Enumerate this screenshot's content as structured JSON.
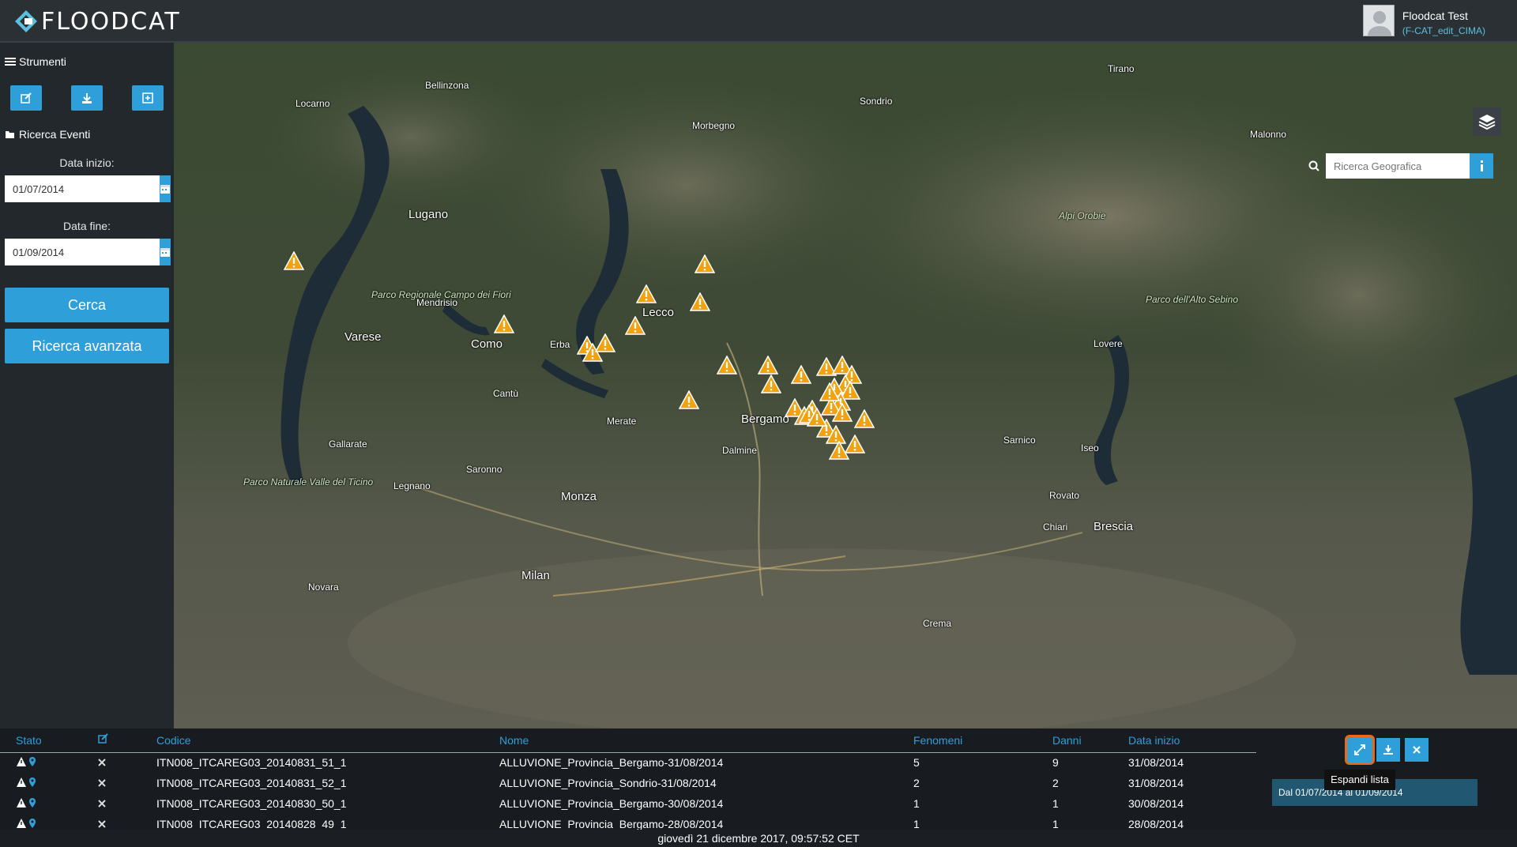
{
  "header": {
    "logo_text": "FLOODCAT",
    "user_name": "Floodcat Test",
    "user_role": "(F-CAT_edit_CIMA)"
  },
  "sidebar": {
    "tools_title": "Strumenti",
    "tool_buttons": [
      "edit-icon",
      "download-icon",
      "expand-icon"
    ],
    "search_title": "Ricerca Eventi",
    "start_label": "Data inizio:",
    "start_value": "01/07/2014",
    "end_label": "Data fine:",
    "end_value": "01/09/2014",
    "search_button": "Cerca",
    "advanced_button": "Ricerca avanzata"
  },
  "map": {
    "geo_search_placeholder": "Ricerca Geografica",
    "places": [
      {
        "name": "Milan",
        "big": true
      },
      {
        "name": "Bergamo",
        "big": true
      },
      {
        "name": "Brescia",
        "big": true
      },
      {
        "name": "Lecco",
        "big": true
      },
      {
        "name": "Como",
        "big": true
      },
      {
        "name": "Varese",
        "big": true
      },
      {
        "name": "Lugano",
        "big": true
      },
      {
        "name": "Monza",
        "big": true
      },
      {
        "name": "Sondrio",
        "big": false
      },
      {
        "name": "Locarno",
        "big": false
      },
      {
        "name": "Novara",
        "big": false
      },
      {
        "name": "Saronno",
        "big": false
      },
      {
        "name": "Legnano",
        "big": false
      },
      {
        "name": "Gallarate",
        "big": false
      },
      {
        "name": "Cantù",
        "big": false
      },
      {
        "name": "Erba",
        "big": false
      },
      {
        "name": "Crema",
        "big": false
      },
      {
        "name": "Lovere",
        "big": false
      },
      {
        "name": "Sarnico",
        "big": false
      },
      {
        "name": "Dalmine",
        "big": false
      },
      {
        "name": "Merate",
        "big": false
      },
      {
        "name": "Mendrisio",
        "big": false
      },
      {
        "name": "Bellinzona",
        "big": false
      },
      {
        "name": "Morbegno",
        "big": false
      },
      {
        "name": "Chiari",
        "big": false
      },
      {
        "name": "Rovato",
        "big": false
      },
      {
        "name": "Iseo",
        "big": false
      },
      {
        "name": "Malonno",
        "big": false
      },
      {
        "name": "Tirano",
        "big": false
      },
      {
        "name": "Parco dell'Alto Sebino",
        "big": false
      },
      {
        "name": "Parco Regionale Campo dei Fiori",
        "big": false
      },
      {
        "name": "Parco Naturale Valle del Ticino",
        "big": false
      },
      {
        "name": "Alpi Orobie",
        "big": false
      }
    ]
  },
  "results": {
    "columns": [
      "Stato",
      "edit-icon",
      "Codice",
      "Nome",
      "Fenomeni",
      "Danni",
      "Data inizio"
    ],
    "rows": [
      {
        "codice": "ITN008_ITCAREG03_20140831_51_1",
        "nome": "ALLUVIONE_Provincia_Bergamo-31/08/2014",
        "fenomeni": "5",
        "danni": "9",
        "data": "31/08/2014"
      },
      {
        "codice": "ITN008_ITCAREG03_20140831_52_1",
        "nome": "ALLUVIONE_Provincia_Sondrio-31/08/2014",
        "fenomeni": "2",
        "danni": "2",
        "data": "31/08/2014"
      },
      {
        "codice": "ITN008_ITCAREG03_20140830_50_1",
        "nome": "ALLUVIONE_Provincia_Bergamo-30/08/2014",
        "fenomeni": "1",
        "danni": "1",
        "data": "30/08/2014"
      },
      {
        "codice": "ITN008_ITCAREG03_20140828_49_1",
        "nome": "ALLUVIONE_Provincia_Bergamo-28/08/2014",
        "fenomeni": "1",
        "danni": "1",
        "data": "28/08/2014"
      }
    ],
    "tooltip": "Espandi lista",
    "range_badge": "Dal 01/07/2014 al 01/09/2014"
  },
  "status": {
    "datetime": "giovedì 21 dicembre 2017, 09:57:52 CET"
  }
}
